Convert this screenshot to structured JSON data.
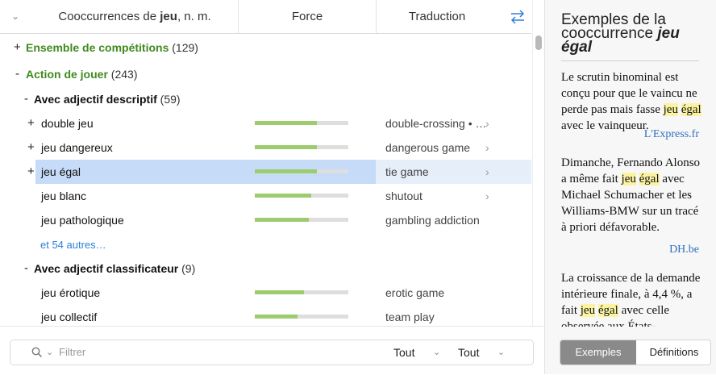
{
  "header": {
    "title_prefix": "Cooccurrences de ",
    "title_word": "jeu",
    "title_suffix": ", n. m.",
    "force_label": "Force",
    "traduction_label": "Traduction"
  },
  "rows": {
    "g1": {
      "exp": "+",
      "label": "Ensemble de compétitions",
      "count": "(129)"
    },
    "g2": {
      "exp": "-",
      "label": "Action de jouer",
      "count": "(243)"
    },
    "s1": {
      "exp": "-",
      "label": "Avec adjectif descriptif",
      "count": "(59)"
    },
    "r1": {
      "exp": "+",
      "word": "double jeu",
      "force": 0.66,
      "trad": "double-crossing • …"
    },
    "r2": {
      "exp": "+",
      "word": "jeu dangereux",
      "force": 0.66,
      "trad": "dangerous game"
    },
    "r3": {
      "exp": "+",
      "word": "jeu égal",
      "force": 0.66,
      "trad": "tie game"
    },
    "r4": {
      "word": "jeu blanc",
      "force": 0.6,
      "trad": "shutout"
    },
    "r5": {
      "word": "jeu pathologique",
      "force": 0.58,
      "trad": "gambling addiction"
    },
    "more": "et 54 autres…",
    "s2": {
      "exp": "-",
      "label": "Avec adjectif classificateur",
      "count": "(9)"
    },
    "r6": {
      "word": "jeu érotique",
      "force": 0.53,
      "trad": "erotic game"
    },
    "r7": {
      "word": "jeu collectif",
      "force": 0.46,
      "trad": "team play"
    }
  },
  "arrow_glyph": "›",
  "filter": {
    "placeholder": "Filtrer",
    "select1": "Tout",
    "select2": "Tout"
  },
  "panel": {
    "title_line": "Exemples de la cooccurrence",
    "title_term": "jeu égal",
    "examples": [
      {
        "before": "Le scrutin binominal est conçu pour que le vaincu ne perde pas mais fasse ",
        "hl1": "jeu",
        "mid": " ",
        "hl2": "égal",
        "after": " avec le vainqueur.",
        "source": "L'Express.fr"
      },
      {
        "before": "Dimanche, Fernando Alonso a même fait ",
        "hl1": "jeu",
        "mid": " ",
        "hl2": "égal",
        "after": " avec Michael Schumacher et les Williams-BMW sur un tracé à priori défavorable.",
        "source": "DH.be"
      },
      {
        "before": "La croissance de la demande intérieure finale, à 4,4 %, a fait ",
        "hl1": "jeu",
        "mid": " ",
        "hl2": "égal",
        "after": " avec celle observée aux États-",
        "source": ""
      }
    ],
    "btn_examples": "Exemples",
    "btn_definitions": "Définitions"
  },
  "colors": {
    "accent": "#2d7fd8",
    "group": "#3f8a1e",
    "bar": "#9ccc6f",
    "selection": "#c6dbf7",
    "highlight": "#fbf3a2"
  }
}
